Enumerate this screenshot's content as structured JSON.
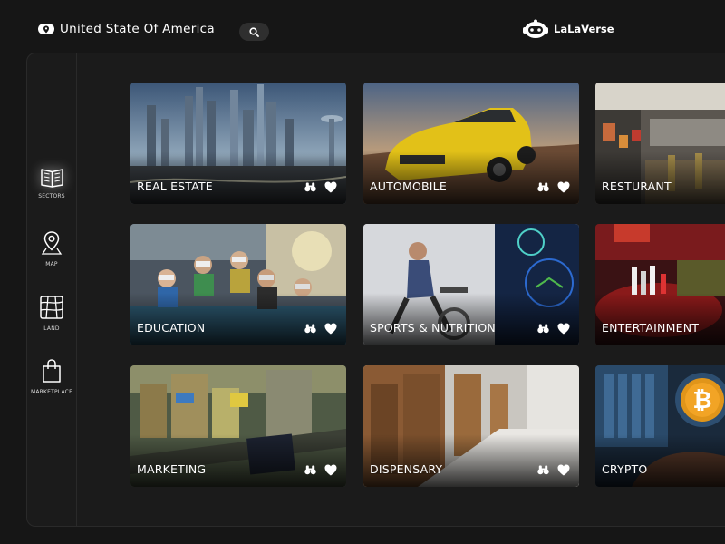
{
  "header": {
    "location_title": "United State Of America",
    "brand_name": "LaLaVerse"
  },
  "sidebar": {
    "items": [
      {
        "label": "SECTORS",
        "icon": "book-map-icon",
        "active": true
      },
      {
        "label": "MAP",
        "icon": "map-pin-icon",
        "active": false
      },
      {
        "label": "LAND",
        "icon": "land-grid-icon",
        "active": false
      },
      {
        "label": "MARKETPLACE",
        "icon": "shopping-bag-icon",
        "active": false
      }
    ]
  },
  "sectors": [
    {
      "label": "REAL ESTATE"
    },
    {
      "label": "AUTOMOBILE"
    },
    {
      "label": "RESTURANT"
    },
    {
      "label": "EDUCATION"
    },
    {
      "label": "SPORTS & NUTRITION"
    },
    {
      "label": "ENTERTAINMENT"
    },
    {
      "label": "MARKETING"
    },
    {
      "label": "DISPENSARY"
    },
    {
      "label": "CRYPTO"
    }
  ],
  "card_actions": {
    "view_icon": "binoculars-icon",
    "favorite_icon": "heart-icon"
  },
  "colors": {
    "background": "#161616",
    "panel": "#1b1b1b",
    "accent": "#f2c200"
  }
}
